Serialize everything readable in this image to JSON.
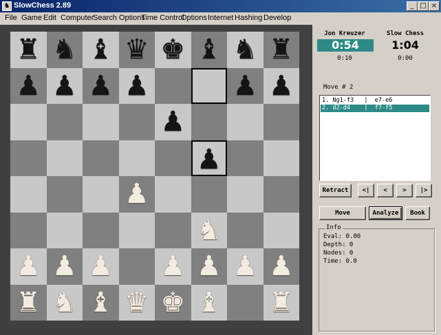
{
  "window": {
    "title": "SlowChess 2.89",
    "minimize": "_",
    "maximize": "□",
    "close": "×"
  },
  "menu": [
    "File",
    "Game",
    "Edit",
    "Computer",
    "Search Options",
    "Time Control",
    "Options",
    "Internet",
    "Hashing",
    "Develop"
  ],
  "board": {
    "colors": {
      "light": "#c8c8c8",
      "dark": "#808080",
      "highlight": "#000000"
    },
    "highlighted": [
      "f7",
      "f5"
    ],
    "ranks": [
      [
        "bR",
        "bN",
        "bB",
        "bQ",
        "bK",
        "bB",
        "bN",
        "bR"
      ],
      [
        "bP",
        "bP",
        "bP",
        "bP",
        "",
        "",
        "bP",
        "bP"
      ],
      [
        "",
        "",
        "",
        "",
        "bP",
        "",
        "",
        ""
      ],
      [
        "",
        "",
        "",
        "",
        "",
        "bP",
        "",
        ""
      ],
      [
        "",
        "",
        "",
        "wP",
        "",
        "",
        "",
        ""
      ],
      [
        "",
        "",
        "",
        "",
        "",
        "wN",
        "",
        ""
      ],
      [
        "wP",
        "wP",
        "wP",
        "",
        "wP",
        "wP",
        "wP",
        "wP"
      ],
      [
        "wR",
        "wN",
        "wB",
        "wQ",
        "wK",
        "wB",
        "",
        "wR"
      ]
    ]
  },
  "players": {
    "white": {
      "name": "Jon Kreuzer",
      "clock": "0:54",
      "increment": "0:10",
      "active": true
    },
    "black": {
      "name": "Slow Chess",
      "clock": "1:04",
      "increment": "0:00",
      "active": false
    }
  },
  "move_header": "Move # 2",
  "moves": [
    {
      "text": "1. Ng1-f3   |  e7-e6",
      "selected": false
    },
    {
      "text": "2. d2-d4    |  f7-f5",
      "selected": true
    }
  ],
  "nav_buttons": {
    "retract": "Retract",
    "first": "<|",
    "prev": "<",
    "next": ">",
    "last": "|>"
  },
  "action_buttons": {
    "move": "Move",
    "analyze": "Analyze",
    "book": "Book"
  },
  "info": {
    "title": "Info",
    "eval": "Eval: 0.00",
    "depth": "Depth: 0",
    "nodes": "Nodes: 0",
    "time": "Time: 0.0"
  },
  "accent_color": "#2d8a86"
}
